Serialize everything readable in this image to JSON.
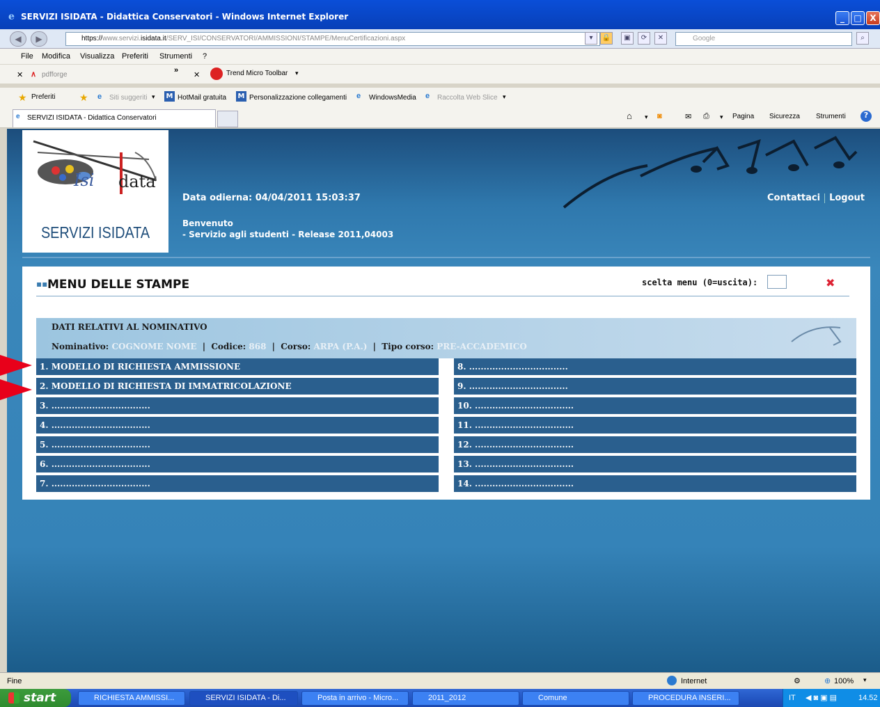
{
  "window": {
    "title": "SERVIZI ISIDATA - Didattica Conservatori - Windows Internet Explorer",
    "minimize": "_",
    "maximize": "□",
    "close": "X"
  },
  "address": {
    "url_prefix": "https://",
    "url_host_pre": "www.servizi.",
    "url_host": "isidata.it",
    "url_path": "/SERV_ISI/CONSERVATORI/AMMISSIONI/STAMPE/MenuCertificazioni.aspx",
    "search_placeholder": "Google"
  },
  "menubar": [
    "File",
    "Modifica",
    "Visualizza",
    "Preferiti",
    "Strumenti",
    "?"
  ],
  "toolbar1": {
    "pdfforge": "pdfforge",
    "chevron": "»",
    "trend": "Trend Micro Toolbar"
  },
  "favorites_bar": {
    "preferiti": "Preferiti",
    "items": [
      "Siti suggeriti",
      "HotMail gratuita",
      "Personalizzazione collegamenti",
      "WindowsMedia",
      "Raccolta Web Slice"
    ]
  },
  "tab": {
    "label": "SERVIZI ISIDATA - Didattica Conservatori",
    "commands": [
      "Pagina",
      "Sicurezza",
      "Strumenti"
    ]
  },
  "header": {
    "logo_text": "SERVIZI ISIDATA",
    "logo_brand": "data",
    "logo_brand_prefix": "Isi",
    "logo_sd": "sd",
    "date_label": "Data odierna: 04/04/2011 15:03:37",
    "welcome": "Benvenuto",
    "service": "- Servizio agli studenti - Release 2011,04003",
    "contact": "Contattaci",
    "logout": "Logout"
  },
  "panel": {
    "title": "MENU DELLE STAMPE",
    "scelta_label": "scelta menu (0=uscita):",
    "scelta_value": "",
    "info_title": "DATI RELATIVI AL NOMINATIVO",
    "nominativo_label": "Nominativo:",
    "nominativo_value": "COGNOME NOME",
    "codice_label": "Codice:",
    "codice_value": "868",
    "corso_label": "Corso:",
    "corso_value": "ARPA (P.A.)",
    "tipo_label": "Tipo corso:",
    "tipo_value": "PRE-ACCADEMICO"
  },
  "menu_left": [
    "1. MODELLO DI RICHIESTA AMMISSIONE",
    "2. MODELLO DI RICHIESTA DI IMMATRICOLAZIONE",
    "3. ..................................",
    "4. ..................................",
    "5. ..................................",
    "6. ..................................",
    "7. .................................."
  ],
  "menu_right": [
    "8. ..................................",
    "9. ..................................",
    "10. ..................................",
    "11. ..................................",
    "12. ..................................",
    "13. ..................................",
    "14. .................................."
  ],
  "statusbar": {
    "left": "Fine",
    "zone": "Internet",
    "zoom": "100%"
  },
  "taskbar": {
    "start": "start",
    "tasks": [
      "RICHIESTA AMMISSI...",
      "SERVIZI ISIDATA - Di...",
      "Posta in arrivo - Micro...",
      "2011_2012",
      "Comune",
      "PROCEDURA INSERI..."
    ],
    "lang": "IT",
    "clock": "14.52"
  },
  "colors": {
    "menu_row": "#2a5f8e",
    "arrow": "#e8001a",
    "logo_text": "#1e4d7a"
  }
}
